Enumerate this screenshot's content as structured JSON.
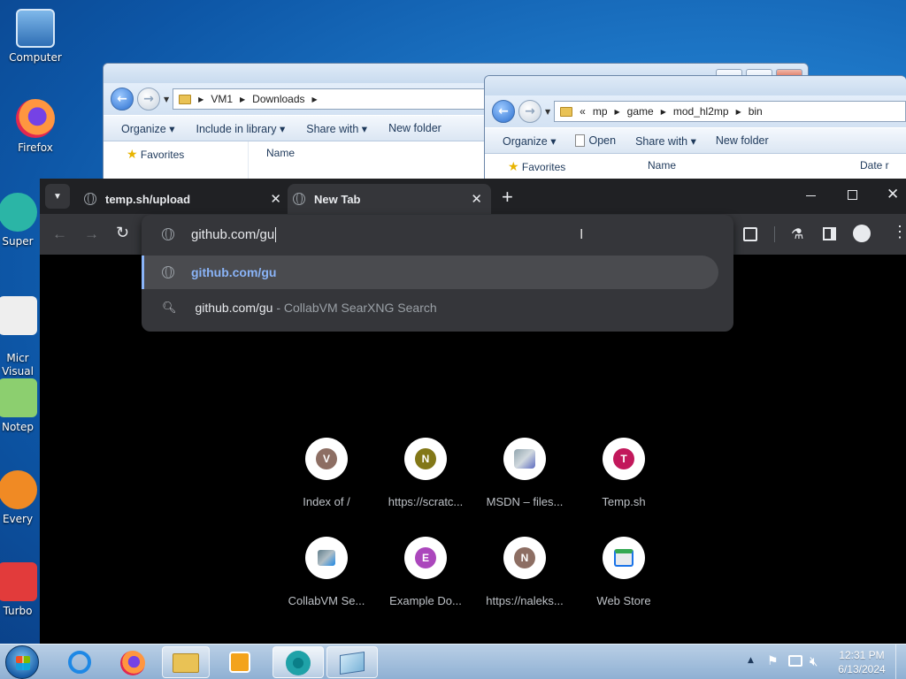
{
  "desktop": {
    "icons": [
      {
        "label": "Computer"
      },
      {
        "label": "Firefox"
      },
      {
        "label": "Super"
      },
      {
        "label": "Micr\nVisual"
      },
      {
        "label": "Notep"
      },
      {
        "label": "Every"
      },
      {
        "label": "Turbo"
      }
    ]
  },
  "explorer1": {
    "path": [
      "VM1",
      "Downloads"
    ],
    "toolbar": [
      "Organize",
      "Include in library",
      "Share with",
      "New folder"
    ],
    "favorites": "Favorites",
    "col_name": "Name"
  },
  "explorer2": {
    "path_prefix": "«",
    "path": [
      "mp",
      "game",
      "mod_hl2mp",
      "bin"
    ],
    "toolbar": [
      "Organize",
      "Open",
      "Share with",
      "New folder"
    ],
    "favorites": "Favorites",
    "col_name": "Name",
    "col_date": "Date r"
  },
  "chrome": {
    "tabs": [
      {
        "title": "temp.sh/upload"
      },
      {
        "title": "New Tab"
      }
    ],
    "omnibox_text": "github.com/gu",
    "suggestions": [
      {
        "text": "github.com/gu",
        "suffix": ""
      },
      {
        "text": "github.com/gu",
        "suffix": " - CollabVM SearXNG Search"
      }
    ],
    "shortcuts": [
      {
        "letter": "V",
        "color": "#8d6e63",
        "label": "Index of /"
      },
      {
        "letter": "N",
        "color": "#827717",
        "label": "https://scratc..."
      },
      {
        "letter": "",
        "color": "#90a4ae",
        "label": "MSDN – files..."
      },
      {
        "letter": "T",
        "color": "#c2185b",
        "label": "Temp.sh"
      },
      {
        "letter": "",
        "color": "#607d8b",
        "label": "CollabVM Se..."
      },
      {
        "letter": "E",
        "color": "#ab47bc",
        "label": "Example Do..."
      },
      {
        "letter": "N",
        "color": "#8d6e63",
        "label": "https://naleks..."
      },
      {
        "letter": "",
        "color": "#1a73e8",
        "label": "Web Store"
      }
    ]
  },
  "taskbar": {
    "time": "12:31 PM",
    "date": "6/13/2024"
  }
}
